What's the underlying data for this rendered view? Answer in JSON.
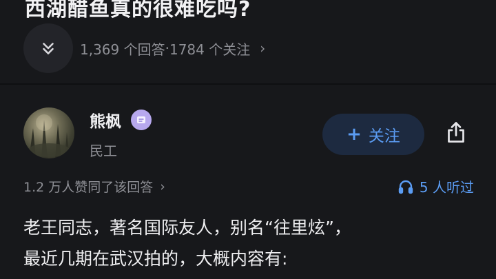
{
  "question": {
    "title": "西湖醋鱼真的很难吃吗?",
    "answers_count": "1,369 个回答",
    "separator": " · ",
    "followers_count": "1784 个关注",
    "meta_chevron": "›"
  },
  "author": {
    "name": "熊枫",
    "title": "民工",
    "follow_plus": "+",
    "follow_label": "关注"
  },
  "stats": {
    "upvotes": "1.2 万人赞同了该回答",
    "upvotes_chevron": "›",
    "listeners": "5 人听过"
  },
  "content": {
    "lines": [
      "老王同志，著名国际友人，别名“往里炫”，",
      "最近几期在武汉拍的，大概内容有:"
    ]
  },
  "colors": {
    "background": "#17181b",
    "accent": "#5b9cf3",
    "muted": "#8e8f95",
    "badge": "#b7a8ee"
  },
  "icons": {
    "collapse": "double-chevron-down-icon",
    "badge": "verified-badge-icon",
    "share": "share-icon",
    "listen": "headphones-icon"
  }
}
